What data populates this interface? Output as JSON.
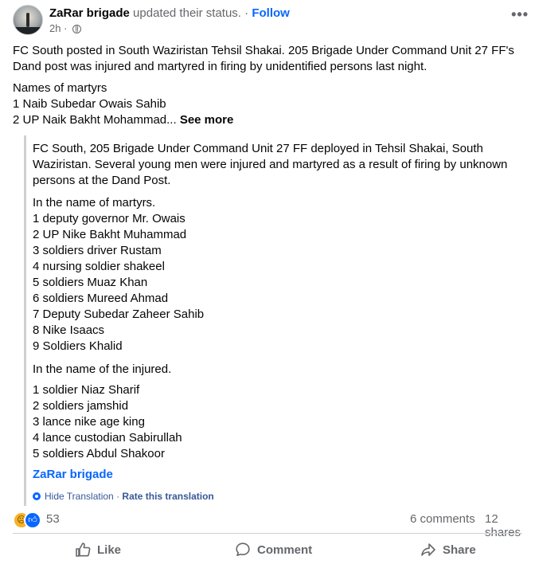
{
  "header": {
    "author": "ZaRar brigade",
    "action": "updated their status.",
    "separator": "·",
    "follow_label": "Follow",
    "time": "2h",
    "time_sep": "·",
    "more_label": "•••"
  },
  "post": {
    "para1": "FC South posted in South Waziristan Tehsil Shakai. 205 Brigade Under Command Unit 27 FF's Dand post was injured and martyred in firing by unidentified persons last night.",
    "names_heading": "Names of martyrs",
    "line1": "1 Naib Subedar Owais Sahib",
    "line2": "2 UP Naik Bakht Mohammad...",
    "see_more": "See more"
  },
  "translation": {
    "para1": "FC South, 205 Brigade Under Command Unit 27 FF deployed in Tehsil Shakai, South Waziristan. Several young men were injured and martyred as a result of firing by unknown persons at the Dand Post.",
    "martyrs_heading": "In the name of martyrs.",
    "martyrs": [
      "1 deputy governor Mr. Owais",
      "2 UP Nike Bakht Muhammad",
      "3 soldiers driver Rustam",
      "4 nursing soldier shakeel",
      "5 soldiers Muaz Khan",
      "6 soldiers Mureed Ahmad",
      "7 Deputy Subedar Zaheer Sahib",
      "8 Nike Isaacs",
      "9 Soldiers Khalid"
    ],
    "injured_heading": "In the name of the injured.",
    "injured": [
      "1 soldier Niaz Sharif",
      "2 soldiers jamshid",
      "3 lance nike age king",
      "4 lance custodian Sabirullah",
      "5 soldiers Abdul Shakoor"
    ],
    "source_name": "ZaRar brigade",
    "hide_label": "Hide Translation",
    "footer_sep": "·",
    "rate_label": "Rate this translation"
  },
  "stats": {
    "reaction_count": "53",
    "comments": "6 comments",
    "shares": "12 shares",
    "reaction_icons": [
      "sad-emoji-icon",
      "like-thumb-icon"
    ]
  },
  "actions": {
    "like_label": "Like",
    "comment_label": "Comment",
    "share_label": "Share"
  },
  "colors": {
    "accent": "#0866ff",
    "secondary_text": "#65676b",
    "divider": "#ced0d4"
  }
}
